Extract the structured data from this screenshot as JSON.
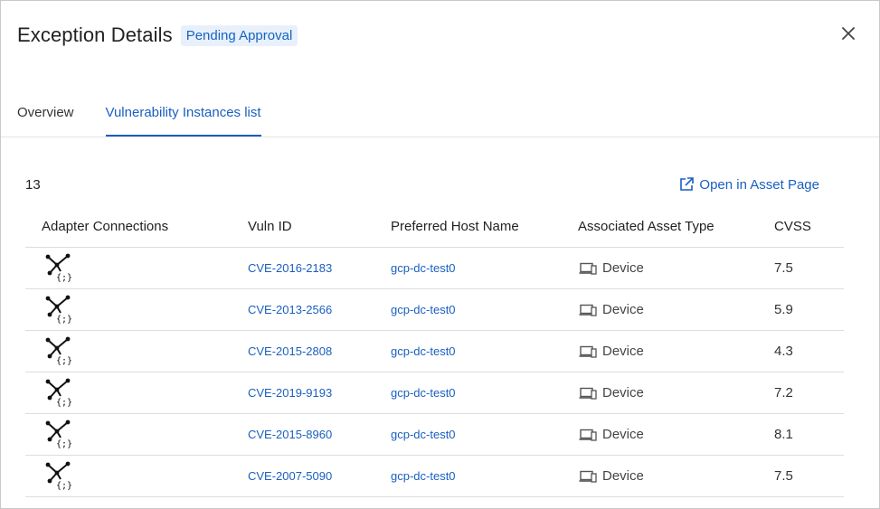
{
  "header": {
    "title": "Exception Details",
    "status_badge": "Pending Approval"
  },
  "tabs": [
    {
      "label": "Overview",
      "active": false
    },
    {
      "label": "Vulnerability Instances list",
      "active": true
    }
  ],
  "toolbar": {
    "count": "13",
    "open_link_label": "Open in Asset Page"
  },
  "table": {
    "columns": [
      "Adapter Connections",
      "Vuln ID",
      "Preferred Host Name",
      "Associated Asset Type",
      "CVSS"
    ],
    "rows": [
      {
        "adapter_icon": "adapter-connection-icon",
        "vuln_id": "CVE-2016-2183",
        "host": "gcp-dc-test0",
        "asset_type": "Device",
        "cvss": "7.5"
      },
      {
        "adapter_icon": "adapter-connection-icon",
        "vuln_id": "CVE-2013-2566",
        "host": "gcp-dc-test0",
        "asset_type": "Device",
        "cvss": "5.9"
      },
      {
        "adapter_icon": "adapter-connection-icon",
        "vuln_id": "CVE-2015-2808",
        "host": "gcp-dc-test0",
        "asset_type": "Device",
        "cvss": "4.3"
      },
      {
        "adapter_icon": "adapter-connection-icon",
        "vuln_id": "CVE-2019-9193",
        "host": "gcp-dc-test0",
        "asset_type": "Device",
        "cvss": "7.2"
      },
      {
        "adapter_icon": "adapter-connection-icon",
        "vuln_id": "CVE-2015-8960",
        "host": "gcp-dc-test0",
        "asset_type": "Device",
        "cvss": "8.1"
      },
      {
        "adapter_icon": "adapter-connection-icon",
        "vuln_id": "CVE-2007-5090",
        "host": "gcp-dc-test0",
        "asset_type": "Device",
        "cvss": "7.5"
      }
    ]
  },
  "colors": {
    "accent": "#1a5fc0",
    "badge_bg": "#e8f0fc",
    "divider": "#dddddd"
  }
}
